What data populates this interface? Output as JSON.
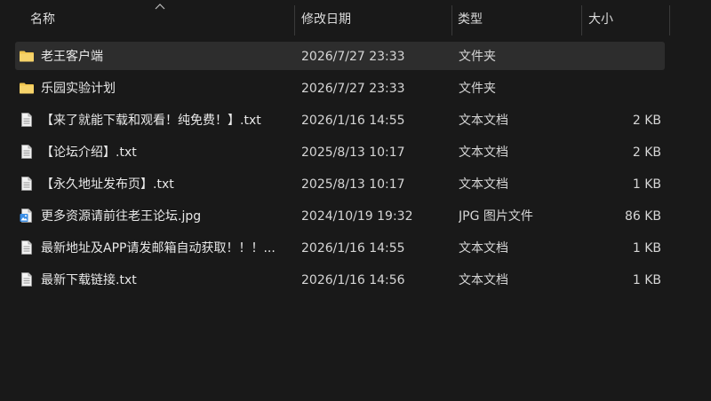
{
  "columns": {
    "name": "名称",
    "date": "修改日期",
    "type": "类型",
    "size": "大小"
  },
  "files": [
    {
      "name": "老王客户端",
      "date": "2026/7/27 23:33",
      "type": "文件夹",
      "size": "",
      "icon": "folder-icon",
      "selected": true
    },
    {
      "name": "乐园实验计划",
      "date": "2026/7/27 23:33",
      "type": "文件夹",
      "size": "",
      "icon": "folder-icon",
      "selected": false
    },
    {
      "name": "【来了就能下载和观看！纯免费！】.txt",
      "date": "2026/1/16 14:55",
      "type": "文本文档",
      "size": "2 KB",
      "icon": "text-file-icon",
      "selected": false
    },
    {
      "name": "【论坛介绍】.txt",
      "date": "2025/8/13 10:17",
      "type": "文本文档",
      "size": "2 KB",
      "icon": "text-file-icon",
      "selected": false
    },
    {
      "name": "【永久地址发布页】.txt",
      "date": "2025/8/13 10:17",
      "type": "文本文档",
      "size": "1 KB",
      "icon": "text-file-icon",
      "selected": false
    },
    {
      "name": "更多资源请前往老王论坛.jpg",
      "date": "2024/10/19 19:32",
      "type": "JPG 图片文件",
      "size": "86 KB",
      "icon": "image-file-icon",
      "selected": false
    },
    {
      "name": "最新地址及APP请发邮箱自动获取！！！...",
      "date": "2026/1/16 14:55",
      "type": "文本文档",
      "size": "1 KB",
      "icon": "text-file-icon",
      "selected": false
    },
    {
      "name": "最新下载链接.txt",
      "date": "2026/1/16 14:56",
      "type": "文本文档",
      "size": "1 KB",
      "icon": "text-file-icon",
      "selected": false
    }
  ],
  "colors": {
    "background": "#191919",
    "selected_row": "#2d2d2d",
    "folder": "#f0c54e",
    "image_icon": "#3a8ee6"
  }
}
